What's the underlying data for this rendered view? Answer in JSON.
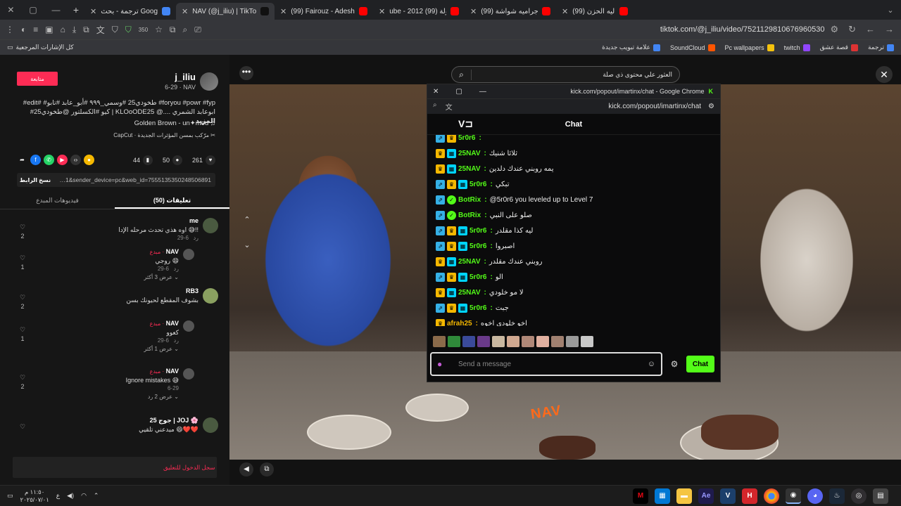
{
  "tabs": [
    {
      "title": "(99) شيله - شمر - ليه الحزن",
      "fav": "#ff0000"
    },
    {
      "title": "(99) شيلة اجراميه شواشة |",
      "fav": "#ff0000"
    },
    {
      "title": "ube - 2012 (99) مقدمة امولة",
      "fav": "#ff0000"
    },
    {
      "title": "(99) Fairouz - Adesh Kan Fi",
      "fav": "#ff0000"
    },
    {
      "title": "NAV (@j_iliu) | TikTok",
      "fav": "#111111",
      "active": true
    },
    {
      "title": "ترجمة - بحث Google",
      "fav": "#4285f4"
    }
  ],
  "browser": {
    "url": "tiktok.com/@j_iliu/video/7521129810676960530",
    "zoom": "350"
  },
  "bookmarks": {
    "all_label": "كل الإشارات المرجعية",
    "items": [
      {
        "label": "ترجمة",
        "color": "#4285f4"
      },
      {
        "label": "قصة عشق",
        "color": "#d33"
      },
      {
        "label": "twitch",
        "color": "#9146ff"
      },
      {
        "label": "Pc wallpapers",
        "color": "#f4c20d"
      },
      {
        "label": "SoundCloud",
        "color": "#ff5500"
      },
      {
        "label": "علامة تبويب جديدة",
        "color": "#4285f4"
      }
    ]
  },
  "post": {
    "username": "j_iliu",
    "nickname": "NAV",
    "date": "6-29",
    "follow_label": "متابعة",
    "caption": "#edit# #طخودي25 #وسمي_٩٩٩ #أبو_عابد #تابو #foryou #powr #fyp #كيو #الكسلتور @طخودي25 | KLOoODE25 @ابوعابد الشمري ....",
    "more_label": "المزيد",
    "music": "Golden Brown - un✦med",
    "effect": "CapCut · مرّكب بمسن المؤثرات الجديدة",
    "likes": "261",
    "comments": "50",
    "saves": "44",
    "link": "…1&sender_device=pc&web_id=7555135350248506891",
    "copy_label": "نسخ الرابط"
  },
  "comment_tabs": {
    "comments": "(50) تعليقات",
    "creator_videos": "فيديوهات المبدع"
  },
  "comments": [
    {
      "name": "me",
      "text": "اوه هذي تحدث مرحله الإدا 😅!!",
      "date": "6-29",
      "reply": "رد",
      "likes": "2"
    },
    {
      "name": "NAV",
      "tag": "مبدع ·",
      "text": "روجي 😄",
      "date": "6-29",
      "reply": "رد",
      "likes": "1",
      "more": "عرض 3 أكثر"
    },
    {
      "name": "RB3",
      "text": "بشوف المقطع لحيونك بسن",
      "date": "",
      "reply": "",
      "likes": "2"
    },
    {
      "name": "NAV",
      "tag": "مبدع ·",
      "text": "كعوو",
      "date": "6-29",
      "reply": "رد",
      "likes": "1",
      "more": "عرض 1 أكثر"
    },
    {
      "name": "NAV",
      "tag": "مبدع ·",
      "text": "Ignore mistakes 😅",
      "date": "6-29",
      "reply": "",
      "likes": "2",
      "more": "عرض 2 رد"
    },
    {
      "name": "جوج 25 | JOJ 🌸",
      "text": "ميدعني تلقيي 😄❤️❤️",
      "date": "",
      "reply": "",
      "likes": ""
    }
  ],
  "login_prompt": "سجل الدخول للتعليق",
  "search": {
    "placeholder": "العثور علي محتوى ذي صلة"
  },
  "video_overlay": "NAV",
  "popout": {
    "title": "kick.com/popout/imartinx/chat - Google Chrome",
    "url": "kick.com/popout/imartinx/chat",
    "header": "Chat",
    "input_placeholder": "Send a message",
    "chat_button": "Chat",
    "messages": [
      {
        "user": "5r0r6",
        "text": "",
        "color": "#53fc18",
        "badges": [
          "sub",
          "crown"
        ]
      },
      {
        "user": "25NAV",
        "text": "ثلاثا شنيك",
        "color": "#53fc18",
        "badges": [
          "crown",
          "mod"
        ]
      },
      {
        "user": "25NAV",
        "text": "يمه روبني عندك دلدين",
        "color": "#53fc18",
        "badges": [
          "crown",
          "mod"
        ]
      },
      {
        "user": "5r0r6",
        "text": "تبكي",
        "color": "#53fc18",
        "badges": [
          "sub",
          "crown",
          "mod"
        ]
      },
      {
        "user": "BotRix",
        "text": "@5r0r6 you leveled up to Level 7",
        "color": "#53fc18",
        "badges": [
          "sub",
          "bot"
        ]
      },
      {
        "user": "BotRix",
        "text": "صلو على النبي",
        "color": "#53fc18",
        "badges": [
          "sub",
          "bot"
        ]
      },
      {
        "user": "5r0r6",
        "text": "ليه كذا مقلدر",
        "color": "#53fc18",
        "badges": [
          "sub",
          "crown",
          "mod"
        ]
      },
      {
        "user": "5r0r6",
        "text": "اصبروا",
        "color": "#53fc18",
        "badges": [
          "sub",
          "crown",
          "mod"
        ]
      },
      {
        "user": "25NAV",
        "text": "روبني عندك مقلدر",
        "color": "#53fc18",
        "badges": [
          "crown",
          "mod"
        ]
      },
      {
        "user": "5r0r6",
        "text": "الو",
        "color": "#53fc18",
        "badges": [
          "sub",
          "crown",
          "mod"
        ]
      },
      {
        "user": "25NAV",
        "text": "لا مو خلودي",
        "color": "#53fc18",
        "badges": [
          "crown",
          "mod"
        ]
      },
      {
        "user": "5r0r6",
        "text": "جبت",
        "color": "#53fc18",
        "badges": [
          "sub",
          "crown",
          "mod"
        ]
      },
      {
        "user": "afrah25",
        "text": "اخو خلودي اخوه",
        "color": "#f5b800",
        "badges": [
          "crown"
        ]
      }
    ]
  },
  "taskbar": {
    "time": "١١:٥٠ م",
    "date": "٢٠٢٥/٠٧/٠١",
    "lang": "ع",
    "apps": [
      "Ae",
      "V",
      "H"
    ]
  }
}
